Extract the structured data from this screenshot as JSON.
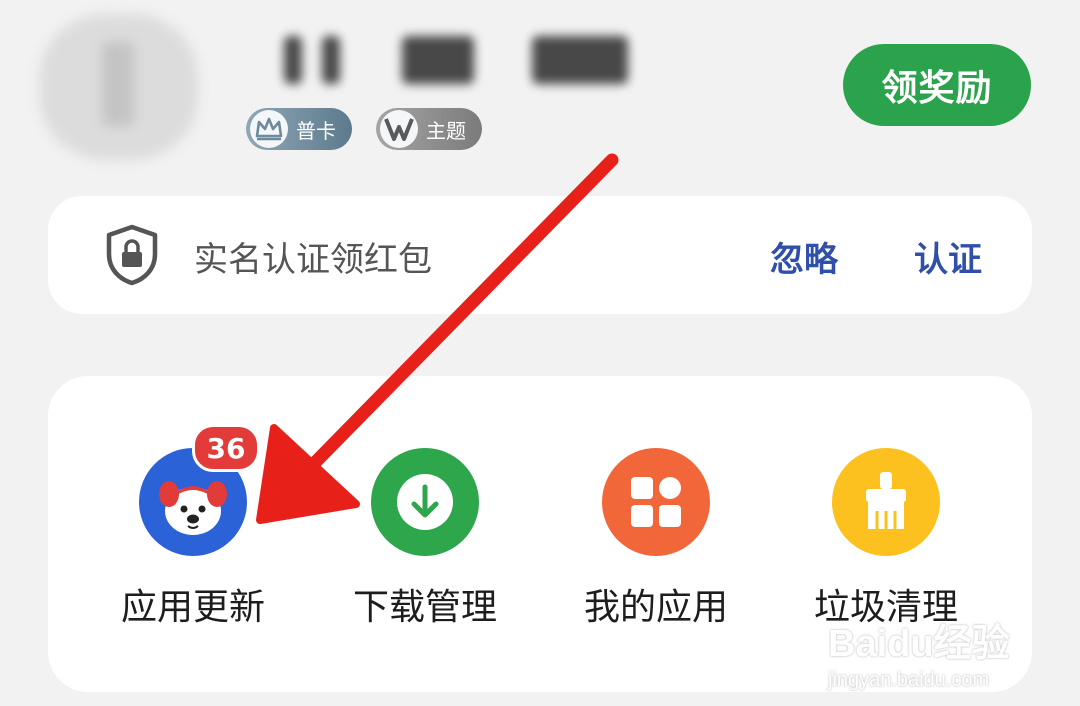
{
  "profile": {
    "badges": [
      {
        "label": "普卡",
        "icon": "crown-icon"
      },
      {
        "label": "主题",
        "icon": "v-logo-icon"
      }
    ]
  },
  "reward_button": {
    "label": "领奖励",
    "color": "#2ba24c"
  },
  "verify_card": {
    "text": "实名认证领红包",
    "ignore_label": "忽略",
    "verify_label": "认证",
    "accent": "#2f4fa9"
  },
  "tools": {
    "items": [
      {
        "label": "应用更新",
        "icon": "dog-mascot-icon",
        "color": "#2b62d8",
        "badge": "36"
      },
      {
        "label": "下载管理",
        "icon": "download-icon",
        "color": "#2ea64c"
      },
      {
        "label": "我的应用",
        "icon": "app-grid-icon",
        "color": "#f2673a"
      },
      {
        "label": "垃圾清理",
        "icon": "broom-icon",
        "color": "#fcc11e"
      }
    ]
  },
  "annotation": {
    "arrow_color": "#e8201a"
  },
  "watermark": {
    "brand": "Baidu经验",
    "url": "jingyan.baidu.com"
  }
}
